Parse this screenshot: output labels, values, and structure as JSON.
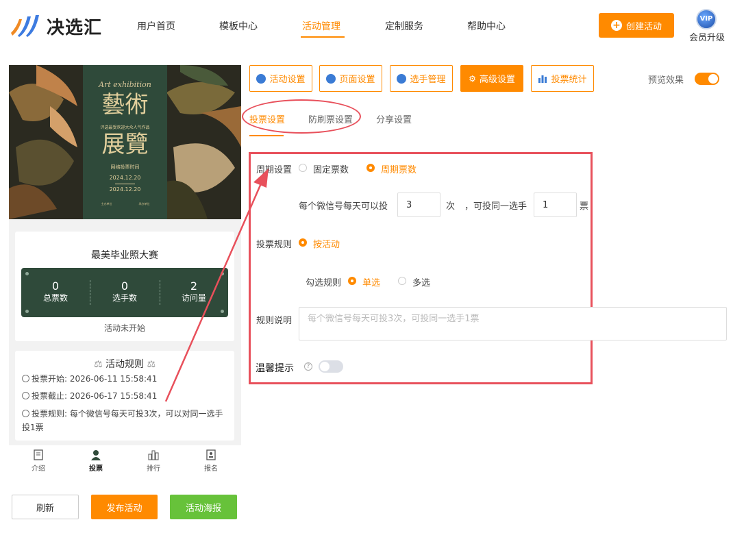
{
  "header": {
    "logo_text": "决选汇",
    "nav": [
      {
        "label": "用户首页",
        "active": false
      },
      {
        "label": "模板中心",
        "active": false
      },
      {
        "label": "活动管理",
        "active": true
      },
      {
        "label": "定制服务",
        "active": false
      },
      {
        "label": "帮助中心",
        "active": false
      }
    ],
    "create_button": "创建活动",
    "vip_badge": "VIP",
    "vip_label": "会员升级"
  },
  "poster": {
    "script_title": "Art exhibition",
    "title_line1": "藝術",
    "subtitle": "评选最受欢迎大众人气作品",
    "title_line2": "展覽",
    "vote_time_label": "网络投票时间",
    "date_start": "2024.12.20",
    "date_end": "2024.12.20",
    "footer_left": "主办单位",
    "footer_right": "承办单位"
  },
  "preview": {
    "contest_title": "最美毕业照大赛",
    "stats": [
      {
        "value": "0",
        "label": "总票数"
      },
      {
        "value": "0",
        "label": "选手数"
      },
      {
        "value": "2",
        "label": "访问量"
      }
    ],
    "status": "活动未开始",
    "rules_title": "活动规则",
    "rules": [
      {
        "label": "投票开始:",
        "value": "2026-06-11 15:58:41"
      },
      {
        "label": "投票截止:",
        "value": "2026-06-17 15:58:41"
      },
      {
        "label": "投票规则:",
        "value": "每个微信号每天可投3次，可以对同一选手投1票"
      }
    ],
    "tabbar": [
      "介绍",
      "投票",
      "排行",
      "报名"
    ]
  },
  "bottom_buttons": {
    "refresh": "刷新",
    "publish": "发布活动",
    "poster": "活动海报"
  },
  "settings_tabs": [
    {
      "label": "活动设置",
      "active": false
    },
    {
      "label": "页面设置",
      "active": false
    },
    {
      "label": "选手管理",
      "active": false
    },
    {
      "label": "高级设置",
      "active": true
    },
    {
      "label": "投票统计",
      "active": false
    }
  ],
  "preview_toggle": {
    "label": "预览效果",
    "on": true
  },
  "sub_tabs": [
    {
      "label": "投票设置",
      "active": true
    },
    {
      "label": "防刷票设置",
      "active": false
    },
    {
      "label": "分享设置",
      "active": false
    }
  ],
  "form": {
    "period_label": "周期设置",
    "period_options": [
      {
        "label": "固定票数",
        "checked": false
      },
      {
        "label": "周期票数",
        "checked": true
      }
    ],
    "per_day_prefix": "每个微信号每天可以投",
    "per_day_value": "3",
    "per_day_unit": "次",
    "same_player_prefix": "，可投同一选手",
    "same_player_value": "1",
    "same_player_unit": "票",
    "vote_rule_label": "投票规则",
    "vote_rule_option": "按活动",
    "check_rule_label": "勾选规则",
    "check_options": [
      {
        "label": "单选",
        "checked": true
      },
      {
        "label": "多选",
        "checked": false
      }
    ],
    "rule_desc_label": "规则说明",
    "rule_desc_placeholder": "每个微信号每天可投3次，可投同一选手1票",
    "tip_label": "温馨提示",
    "tip_help": "?",
    "tip_on": false
  },
  "colors": {
    "accent": "#ff8a00",
    "green": "#67c23a",
    "annotation_red": "#e8505b",
    "stats_bg": "#2f4a3a"
  }
}
